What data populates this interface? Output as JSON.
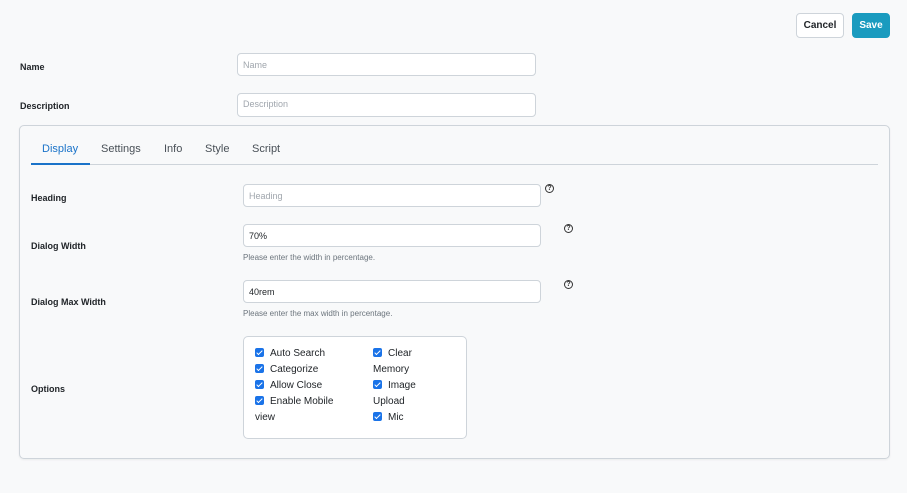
{
  "header": {
    "cancel_label": "Cancel",
    "save_label": "Save"
  },
  "form": {
    "name": {
      "label": "Name",
      "placeholder": "Name",
      "value": ""
    },
    "description": {
      "label": "Description",
      "placeholder": "Description",
      "value": ""
    }
  },
  "tabs": [
    {
      "label": "Display",
      "active": true
    },
    {
      "label": "Settings",
      "active": false
    },
    {
      "label": "Info",
      "active": false
    },
    {
      "label": "Style",
      "active": false
    },
    {
      "label": "Script",
      "active": false
    }
  ],
  "display": {
    "heading": {
      "label": "Heading",
      "placeholder": "Heading",
      "value": ""
    },
    "dialog_width": {
      "label": "Dialog Width",
      "value": "70%",
      "hint": "Please enter the width in percentage."
    },
    "dialog_max_width": {
      "label": "Dialog Max Width",
      "value": "40rem",
      "hint": "Please enter the max width in percentage."
    },
    "options": {
      "label": "Options",
      "left": [
        {
          "label": "Auto Search",
          "checked": true
        },
        {
          "label": "Categorize",
          "checked": true
        },
        {
          "label": "Allow Close",
          "checked": true
        },
        {
          "label": "Enable Mobile",
          "label2": "view",
          "checked": true
        }
      ],
      "right": [
        {
          "label": "Clear",
          "label2": "Memory",
          "checked": true
        },
        {
          "label": "Image",
          "label2": "Upload",
          "checked": true
        },
        {
          "label": "Mic",
          "checked": true
        }
      ]
    },
    "help_glyph": "?"
  },
  "colors": {
    "accent": "#1a9bbf",
    "tab_active": "#1a73c9",
    "checkbox": "#1a73e8"
  },
  "icons": {
    "help": "question-circle-icon",
    "check": "checkmark-icon"
  }
}
